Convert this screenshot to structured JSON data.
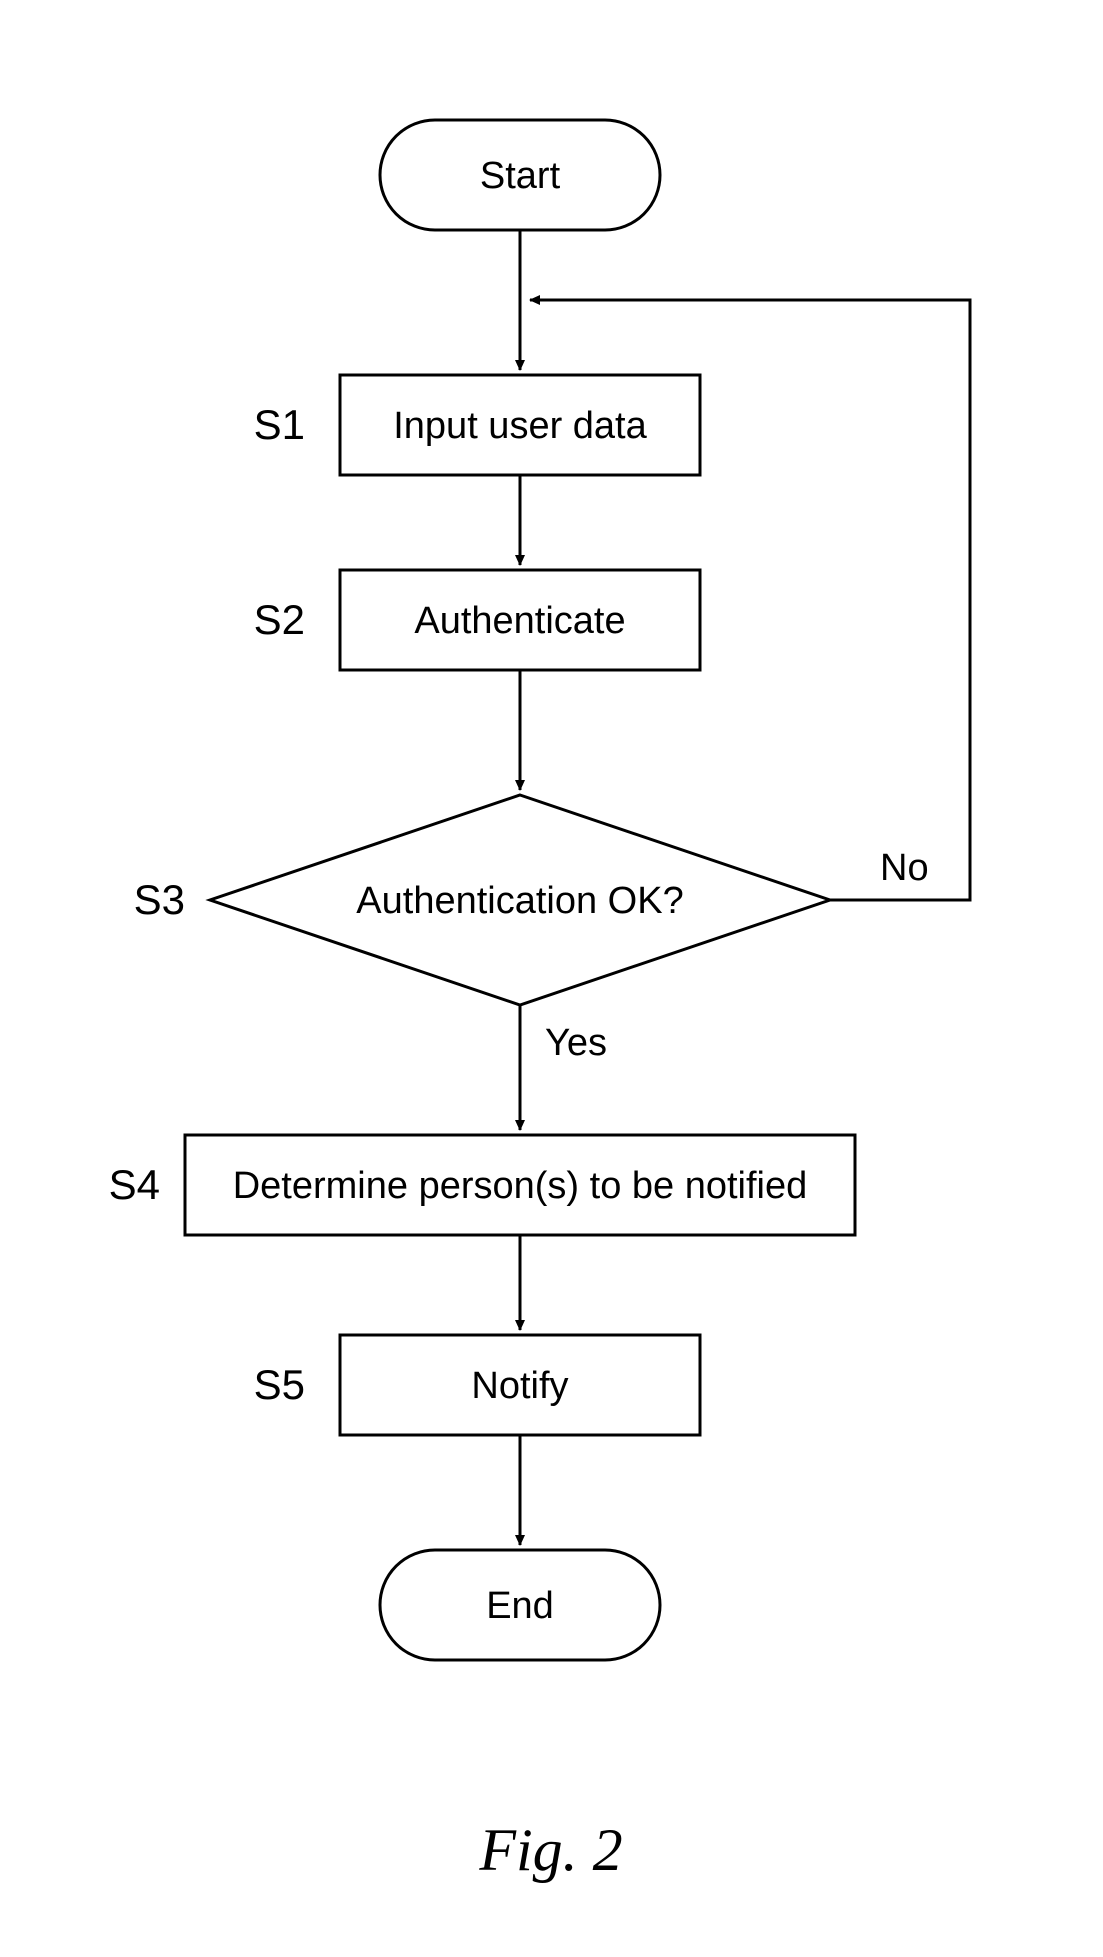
{
  "nodes": {
    "start": {
      "label": "Start"
    },
    "s1": {
      "step": "S1",
      "label": "Input user data"
    },
    "s2": {
      "step": "S2",
      "label": "Authenticate"
    },
    "s3": {
      "step": "S3",
      "label": "Authentication OK?"
    },
    "s4": {
      "step": "S4",
      "label": "Determine person(s) to be notified"
    },
    "s5": {
      "step": "S5",
      "label": "Notify"
    },
    "end": {
      "label": "End"
    }
  },
  "edges": {
    "s3_yes": "Yes",
    "s3_no": "No"
  },
  "caption": "Fig. 2"
}
